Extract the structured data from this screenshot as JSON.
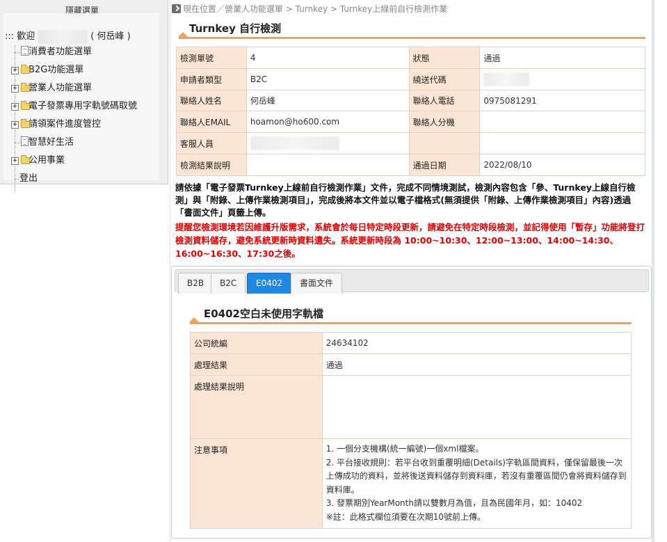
{
  "sidebar": {
    "toggle_label": "隱藏選單",
    "welcome_prefix": "::: 歡迎",
    "welcome_name": "( 何岳峰 )",
    "items": [
      {
        "label": "消費者功能選單",
        "icon": "document-icon",
        "expand": false
      },
      {
        "label": "B2G功能選單",
        "icon": "folder-icon",
        "expand": true
      },
      {
        "label": "營業人功能選單",
        "icon": "folder-icon",
        "expand": true
      },
      {
        "label": "電子發票專用字軌號碼取號",
        "icon": "folder-icon",
        "expand": true
      },
      {
        "label": "請領案件進度管控",
        "icon": "folder-icon",
        "expand": true
      },
      {
        "label": "智慧好生活",
        "icon": "document-icon",
        "expand": false
      },
      {
        "label": "公用事業",
        "icon": "folder-icon",
        "expand": true
      },
      {
        "label": "登出",
        "icon": "",
        "expand": false
      }
    ]
  },
  "breadcrumb": {
    "text": "現在位置／營業人功能選單 > Turnkey > Turnkey上線前自行檢測作業"
  },
  "page_title": "Turnkey 自行檢測",
  "info_table": {
    "test_no_label": "檢測單號",
    "test_no": "4",
    "status_label": "狀態",
    "status": "通過",
    "applicant_type_label": "申請者類型",
    "applicant_type": "B2C",
    "transfer_code_label": "繞送代碼",
    "contact_name_label": "聯絡人姓名",
    "contact_name": "何岳峰",
    "contact_phone_label": "聯絡人電話",
    "contact_phone": "0975081291",
    "contact_email_label": "聯絡人EMAIL",
    "contact_email": "hoamon@ho600.com",
    "contact_ext_label": "聯絡人分機",
    "contact_ext": "",
    "service_staff_label": "客服人員",
    "result_desc_label": "檢測結果說明",
    "result_desc": "",
    "pass_date_label": "通過日期",
    "pass_date": "2022/08/10"
  },
  "notice": "請依據「電子發票Turnkey上線前自行檢測作業」文件，完成不同情境測試，檢測內容包含「參、Turnkey上線自行檢測」與「附錄、上傳作業檢測項目」，完成後將本文件並以電子檔格式(無須提供「附錄、上傳作業檢測項目」內容)透過「書面文件」頁籤上傳。",
  "warning": "提醒您檢測環境若因維護升版需求，系統會於每日特定時段更新，請避免在特定時段檢測，並記得使用「暫存」功能將登打檢測資料儲存，避免系統更新時資料遺失。系統更新時段為 10:00~10:30、12:00~13:00、14:00~14:30、16:00~16:30、17:30之後。",
  "tabs": [
    {
      "label": "B2B",
      "active": false
    },
    {
      "label": "B2C",
      "active": false
    },
    {
      "label": "E0402",
      "active": true
    },
    {
      "label": "書面文件",
      "active": false
    }
  ],
  "e0402": {
    "title": "E0402空白未使用字軌檔",
    "company_id_label": "公司統編",
    "company_id": "24634102",
    "result_label": "處理結果",
    "result": "通過",
    "result_desc_label": "處理結果說明",
    "result_desc": "",
    "notes_label": "注意事項",
    "notes": [
      "1. 一個分支機構(統一編號)一個xml檔案。",
      "2. 平台接收規則：若平台收到重覆明細(Details)字軌區間資料，僅保留最後一次上傳成功的資料，並將後送資料儲存到資料庫，若沒有重覆區間仍會將資料儲存到資料庫。",
      "3. 發票期別YearMonth請以雙數月為值，且為民國年月，如：10402",
      "※註：此格式欄位須要在次期10號前上傳。"
    ]
  },
  "colors": {
    "label_bg": "#fde5d6",
    "title_rule": "#f0a45a",
    "warning_text": "#e60000",
    "tab_active": "#1e88e5"
  }
}
